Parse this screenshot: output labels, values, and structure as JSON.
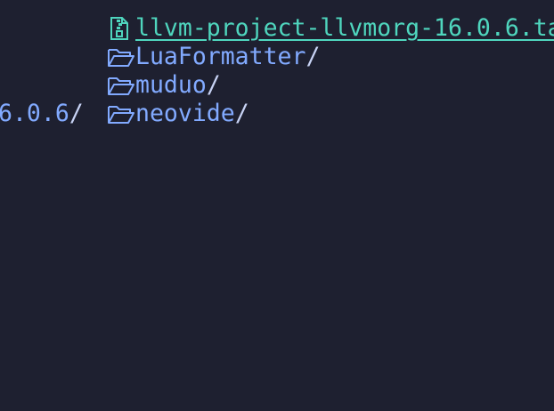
{
  "colors": {
    "background": "#1e2030",
    "directory": "#82aaff",
    "archive": "#4fd6be",
    "separator": "#c8d3f5"
  },
  "left_column": {
    "items": [
      {
        "name": "6.0.6",
        "suffix": "/",
        "icon": "none"
      }
    ]
  },
  "right_column": {
    "items": [
      {
        "name": "llvm-project-llvmorg-16.0.6.ta",
        "suffix": "",
        "icon": "zip-archive-icon",
        "kind": "archive"
      },
      {
        "name": "LuaFormatter",
        "suffix": "/",
        "icon": "folder-icon",
        "kind": "directory"
      },
      {
        "name": "muduo",
        "suffix": "/",
        "icon": "folder-icon",
        "kind": "directory"
      },
      {
        "name": "neovide",
        "suffix": "/",
        "icon": "folder-icon",
        "kind": "directory"
      }
    ]
  }
}
